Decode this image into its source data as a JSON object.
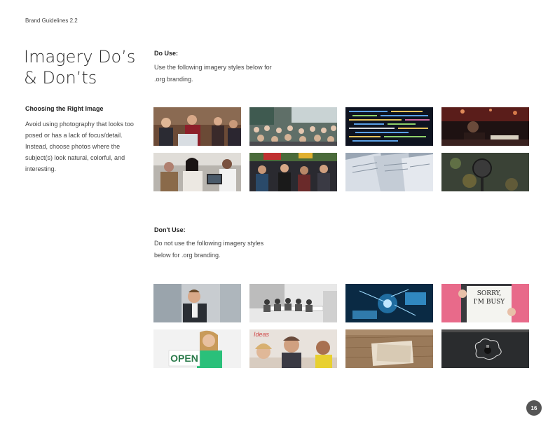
{
  "header": {
    "doc_title": "Brand Guidelines 2.2"
  },
  "title": {
    "line1": "Imagery Do’s",
    "line2": "& Don’ts"
  },
  "intro": {
    "heading": "Choosing the Right Image",
    "body": "Avoid using photography that looks too posed or has a lack of focus/detail. Instead, choose photos where the subject(s) look natural, colorful, and interesting."
  },
  "do_use": {
    "heading": "Do Use:",
    "body": "Use the following imagery styles below for .org branding.",
    "images": [
      {
        "icon": "meeting-photo"
      },
      {
        "icon": "conference-audience-photo"
      },
      {
        "icon": "code-screen-photo"
      },
      {
        "icon": "dark-presentation-photo"
      },
      {
        "icon": "laptop-workers-photo"
      },
      {
        "icon": "crowd-event-photo"
      },
      {
        "icon": "newspapers-photo"
      },
      {
        "icon": "microphone-photo"
      }
    ]
  },
  "dont_use": {
    "heading": "Don't Use:",
    "body": "Do not use the following imagery styles below for .org branding.",
    "images": [
      {
        "icon": "posed-businessman-photo"
      },
      {
        "icon": "grayscale-office-photo"
      },
      {
        "icon": "tech-graphic-photo"
      },
      {
        "icon": "sorry-busy-sign-photo",
        "caption": "SORRY,\nI'M BUSY"
      },
      {
        "icon": "open-sign-photo",
        "caption": "OPEN"
      },
      {
        "icon": "posed-idea-photo",
        "caption": "Ideas"
      },
      {
        "icon": "desk-papers-photo"
      },
      {
        "icon": "chalkboard-bulb-photo"
      }
    ]
  },
  "page_number": "16"
}
